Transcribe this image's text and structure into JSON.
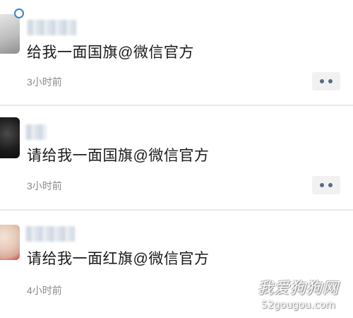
{
  "feed": {
    "posts": [
      {
        "content": "给我一面国旗@微信官方",
        "time": "3小时前",
        "has_more_button": true
      },
      {
        "content": "请给我一面国旗@微信官方",
        "time": "3小时前",
        "has_more_button": true
      },
      {
        "content": "请给我一面红旗@微信官方",
        "time": "4小时前",
        "has_more_button": false
      }
    ]
  },
  "watermark": {
    "main": "我爱狗狗网",
    "sub": "52gougou.com"
  },
  "colors": {
    "text": "#1a1a1a",
    "time": "#8a8a8a",
    "more_button_bg": "#f1f1f1",
    "more_dots": "#5a6b86",
    "divider": "#e9e9e9",
    "avatar_ring": "#3b82c4"
  },
  "icons": {
    "more": "more-dots-icon",
    "avatar_status": "status-ring-icon"
  }
}
